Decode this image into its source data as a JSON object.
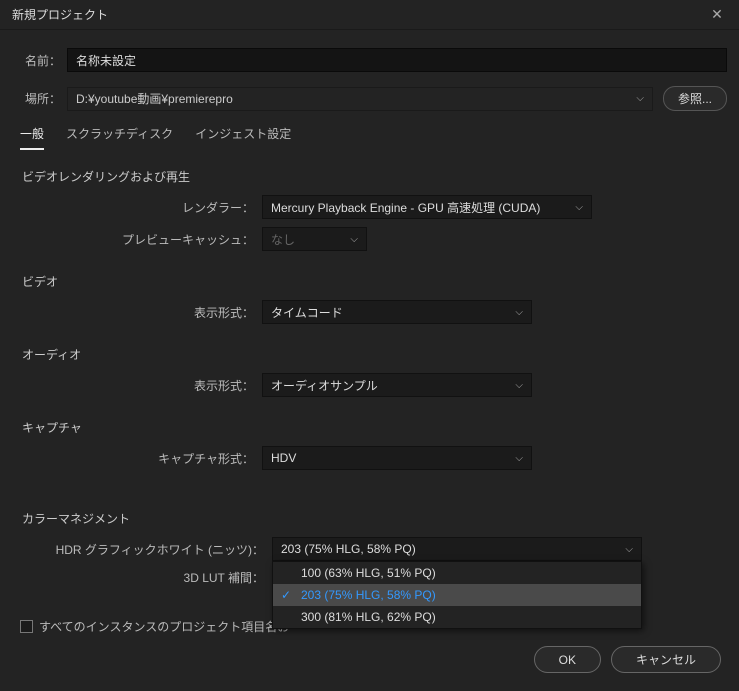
{
  "titlebar": {
    "title": "新規プロジェクト"
  },
  "name": {
    "label": "名前：",
    "value": "名称未設定"
  },
  "location": {
    "label": "場所：",
    "value": "D:¥youtube動画¥premierepro",
    "browse": "参照..."
  },
  "tabs": {
    "general": "一般",
    "scratch": "スクラッチディスク",
    "ingest": "インジェスト設定"
  },
  "sections": {
    "rendering": {
      "title": "ビデオレンダリングおよび再生",
      "renderer_label": "レンダラー：",
      "renderer_value": "Mercury Playback Engine - GPU 高速処理 (CUDA)",
      "preview_cache_label": "プレビューキャッシュ：",
      "preview_cache_value": "なし"
    },
    "video": {
      "title": "ビデオ",
      "display_label": "表示形式：",
      "display_value": "タイムコード"
    },
    "audio": {
      "title": "オーディオ",
      "display_label": "表示形式：",
      "display_value": "オーディオサンプル"
    },
    "capture": {
      "title": "キャプチャ",
      "format_label": "キャプチャ形式：",
      "format_value": "HDV"
    },
    "color": {
      "title": "カラーマネジメント",
      "hdr_label": "HDR グラフィックホワイト (ニッツ)：",
      "hdr_value": "203 (75% HLG, 58% PQ)",
      "lut_label": "3D LUT 補間：",
      "dropdown": {
        "opt1": "100 (63% HLG, 51% PQ)",
        "opt2": "203 (75% HLG, 58% PQ)",
        "opt3": "300 (81% HLG, 62% PQ)"
      }
    }
  },
  "checkbox_label": "すべてのインスタンスのプロジェクト項目名お",
  "footer": {
    "ok": "OK",
    "cancel": "キャンセル"
  }
}
